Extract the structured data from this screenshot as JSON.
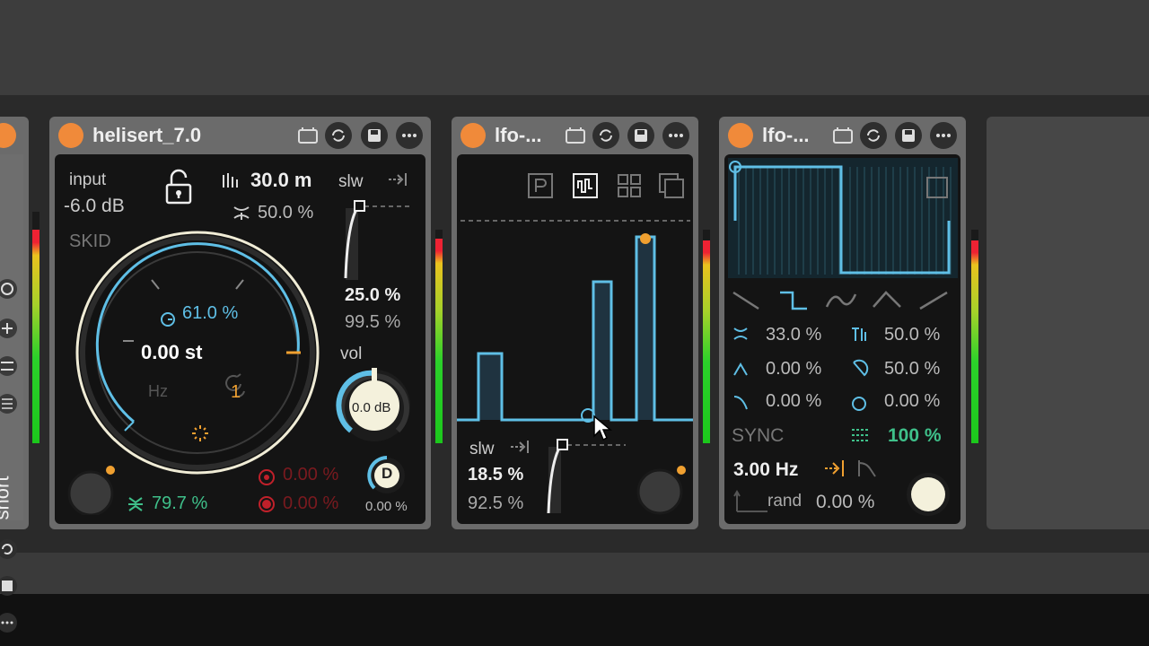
{
  "colors": {
    "accent": "#f08a3a",
    "blue": "#5fbfe6",
    "green": "#3fc08a",
    "red": "#c0202a"
  },
  "left_strip": {
    "label": "short"
  },
  "device1": {
    "title": "helisert_7.0",
    "input_label": "input",
    "input_value": "-6.0 dB",
    "mode_label": "SKID",
    "time_value": "30.0 m",
    "mix_value": "50.0 %",
    "slw_label": "slw",
    "slw_top": "25.0 %",
    "slw_bottom": "99.5 %",
    "knob_pct": "61.0 %",
    "knob_st": "0.00 st",
    "hz_label": "Hz",
    "knob_count": "1",
    "vol_label": "vol",
    "vol_value": "0.0 dB",
    "feedback_value": "79.7 %",
    "red1_value": "0.00 %",
    "red2_value": "0.00 %",
    "d_label": "D",
    "d_value": "0.00 %"
  },
  "device2": {
    "title": "lfo-...",
    "slw_label": "slw",
    "slw_top": "18.5 %",
    "slw_bottom": "92.5 %"
  },
  "device3": {
    "title": "lfo-...",
    "p1": "33.0 %",
    "p2": "50.0 %",
    "p3": "0.00 %",
    "p4": "50.0 %",
    "p5": "0.00 %",
    "p6": "0.00 %",
    "sync_label": "SYNC",
    "sync_value": "100 %",
    "rate": "3.00 Hz",
    "rand_label": "rand",
    "rand_value": "0.00 %"
  }
}
